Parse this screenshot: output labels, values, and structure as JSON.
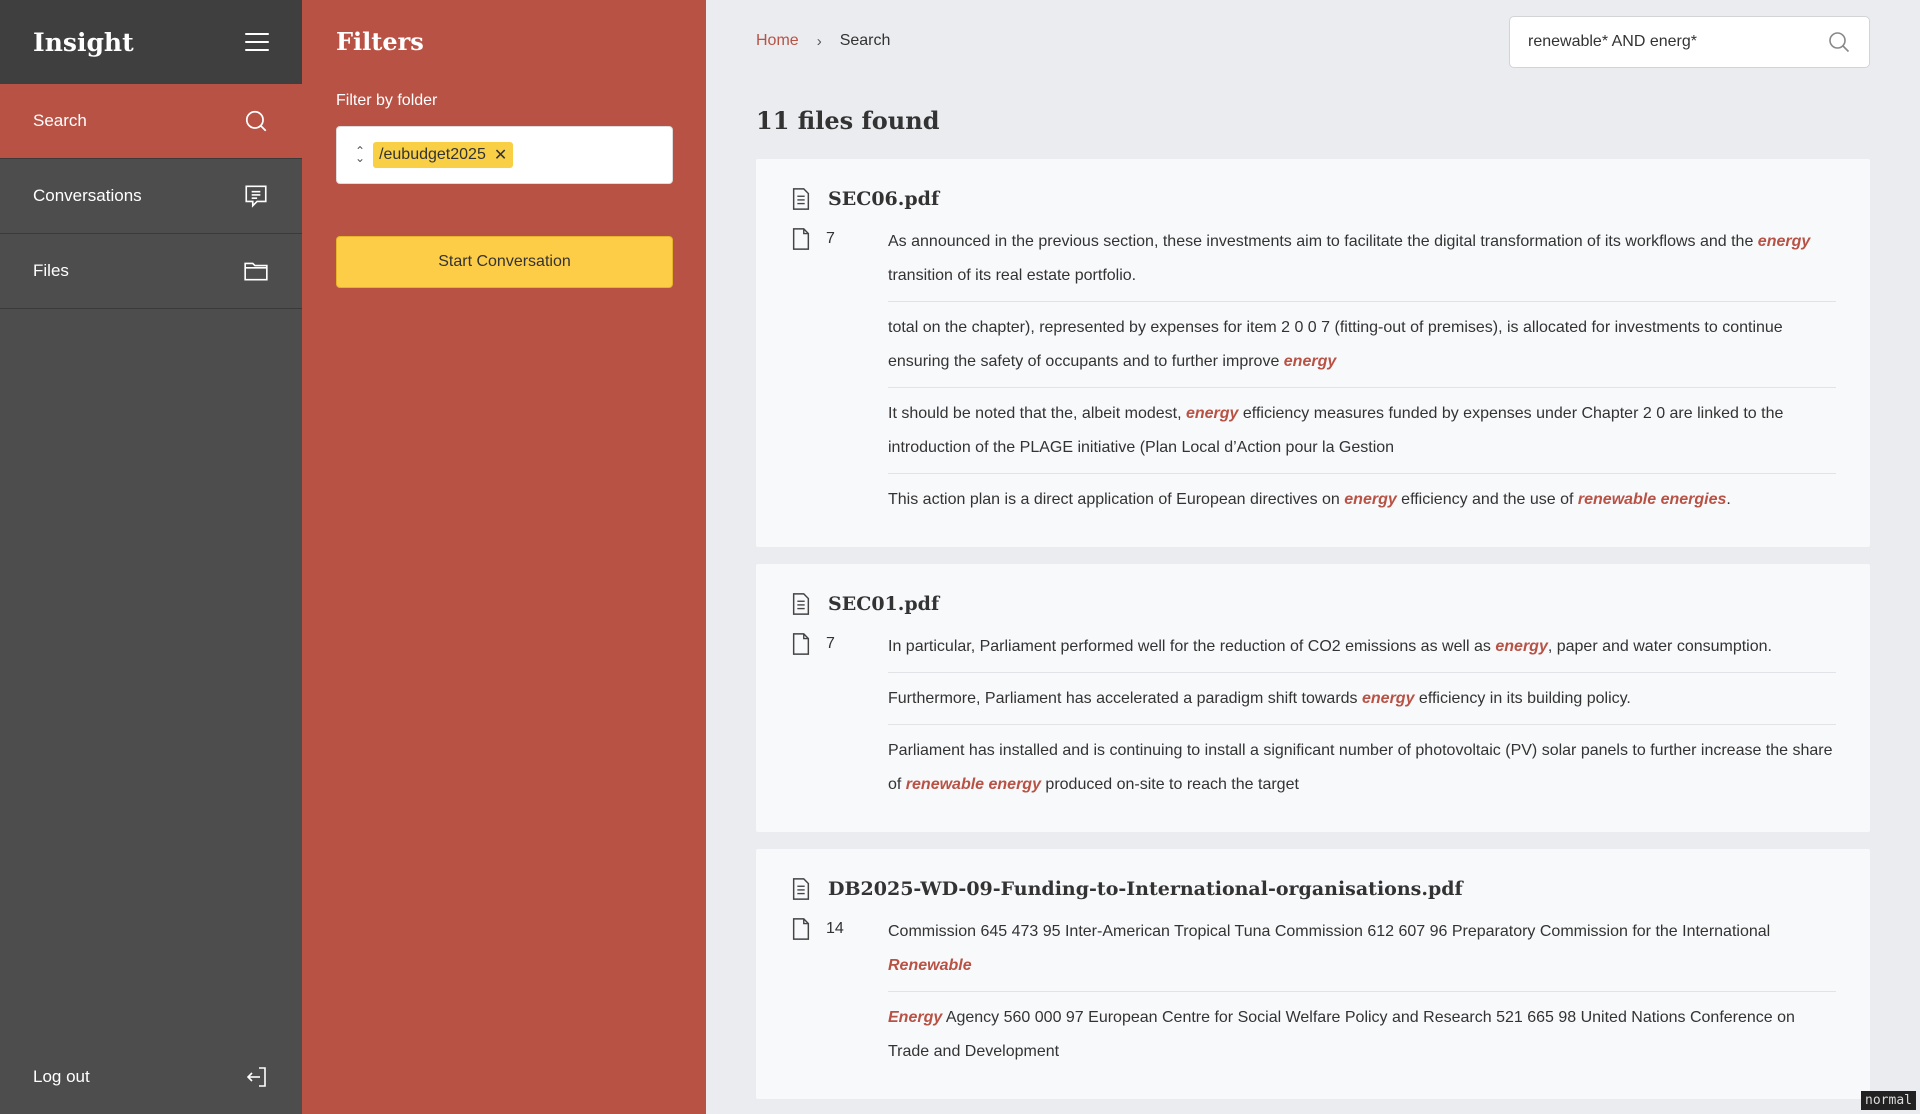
{
  "app": {
    "title": "Insight"
  },
  "sidebar": {
    "items": [
      {
        "label": "Search",
        "icon": "search-icon",
        "active": true
      },
      {
        "label": "Conversations",
        "icon": "chat-icon",
        "active": false
      },
      {
        "label": "Files",
        "icon": "folder-icon",
        "active": false
      }
    ],
    "logout_label": "Log out"
  },
  "filters": {
    "title": "Filters",
    "folder_label": "Filter by folder",
    "selected_folder": "/eubudget2025",
    "start_button": "Start Conversation"
  },
  "breadcrumb": {
    "home": "Home",
    "current": "Search"
  },
  "search": {
    "query": "renewable* AND energ*"
  },
  "results": {
    "count_label": "11 files found",
    "files": [
      {
        "name": "SEC06.pdf",
        "page": "7",
        "snippets": [
          [
            {
              "t": "As announced in the previous section, these investments aim to facilitate the digital transformation of its workflows and the "
            },
            {
              "t": "energy",
              "hl": true
            },
            {
              "t": " transition of its real estate portfolio."
            }
          ],
          [
            {
              "t": "total on the chapter), represented by expenses for item 2 0 0 7 (fitting-out of premises), is allocated for investments to continue ensuring the safety of occupants and to further improve "
            },
            {
              "t": "energy",
              "hl": true
            }
          ],
          [
            {
              "t": "It should be noted that the, albeit modest, "
            },
            {
              "t": "energy",
              "hl": true
            },
            {
              "t": " efficiency measures funded by expenses under Chapter 2 0 are linked to the introduction of the PLAGE initiative (Plan Local d’Action pour la Gestion"
            }
          ],
          [
            {
              "t": "This action plan is a direct application of European directives on "
            },
            {
              "t": "energy",
              "hl": true
            },
            {
              "t": " efficiency and the use of "
            },
            {
              "t": "renewable energies",
              "hl": true
            },
            {
              "t": "."
            }
          ]
        ]
      },
      {
        "name": "SEC01.pdf",
        "page": "7",
        "snippets": [
          [
            {
              "t": "In particular, Parliament performed well for the reduction of CO2 emissions as well as "
            },
            {
              "t": "energy",
              "hl": true
            },
            {
              "t": ", paper and water consumption."
            }
          ],
          [
            {
              "t": "Furthermore, Parliament has accelerated a paradigm shift towards "
            },
            {
              "t": "energy",
              "hl": true
            },
            {
              "t": " efficiency in its building policy."
            }
          ],
          [
            {
              "t": "Parliament has installed and is continuing to install a significant number of photovoltaic (PV) solar panels to further increase the share of "
            },
            {
              "t": "renewable energy",
              "hl": true
            },
            {
              "t": " produced on-site to reach the target"
            }
          ]
        ]
      },
      {
        "name": "DB2025-WD-09-Funding-to-International-organisations.pdf",
        "page": "14",
        "snippets": [
          [
            {
              "t": "Commission 645 473 95 Inter-American Tropical Tuna Commission 612 607 96 Preparatory Commission for the International "
            },
            {
              "t": "Renewable",
              "hl": true
            }
          ],
          [
            {
              "t": "Energy",
              "hl": true
            },
            {
              "t": " Agency 560 000 97 European Centre for Social Welfare Policy and Research 521 665 98 United Nations Conference on Trade and Development"
            }
          ]
        ]
      }
    ]
  },
  "mode_badge": "normal",
  "colors": {
    "accent": "#b85245",
    "sidebar": "#4d4d4d",
    "button": "#fdcd47"
  }
}
